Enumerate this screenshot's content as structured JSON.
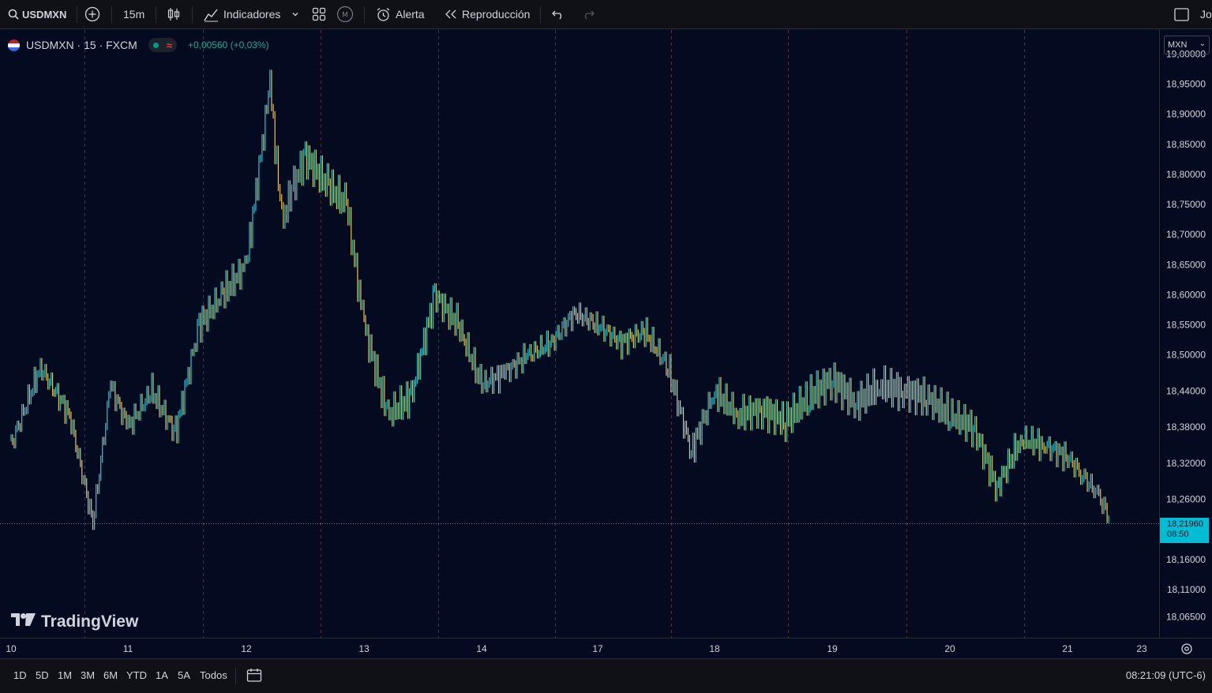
{
  "toolbar": {
    "symbol": "USDMXN",
    "interval": "15m",
    "indicators_label": "Indicadores",
    "alert_label": "Alerta",
    "replay_label": "Reproducción",
    "right_text": "Jo"
  },
  "legend": {
    "title": "USDMXN · 15 · FXCM",
    "change": "+0,00560 (+0,03%)"
  },
  "currency_select": "MXN",
  "price_axis": {
    "labels": [
      "19,00000",
      "18,95000",
      "18,90000",
      "18,85000",
      "18,80000",
      "18,75000",
      "18,70000",
      "18,65000",
      "18,60000",
      "18,55000",
      "18,50000",
      "18,44000",
      "18,38000",
      "18,32000",
      "18,26000",
      "18,16000",
      "18,11000",
      "18,06500"
    ],
    "current_price": "18,21960",
    "countdown": "08:50"
  },
  "time_axis": {
    "labels": [
      "10",
      "11",
      "12",
      "13",
      "14",
      "17",
      "18",
      "19",
      "20",
      "21",
      "23"
    ]
  },
  "ranges": [
    "1D",
    "5D",
    "1M",
    "3M",
    "6M",
    "YTD",
    "1A",
    "5A",
    "Todos"
  ],
  "clock": "08:21:09 (UTC-6)",
  "brand": "TradingView",
  "colors": {
    "up": "#26c6da",
    "down": "#e8c25a",
    "background": "#040b20",
    "price_line": "#00bcd4"
  },
  "chart_data": {
    "type": "line",
    "title": "USDMXN · 15 · FXCM",
    "xlabel": "",
    "ylabel": "",
    "ylim": [
      18.03,
      19.04
    ],
    "grid": "vertical dashed session separators",
    "categories": [
      "10",
      "11",
      "12",
      "13",
      "14",
      "17",
      "18",
      "19",
      "20",
      "21"
    ],
    "series": [
      {
        "x": [
          10.0,
          10.25,
          10.5,
          10.7,
          10.85,
          11.0,
          11.2,
          11.4,
          11.6,
          11.8,
          12.0,
          12.2,
          12.3,
          12.4,
          12.5,
          12.7,
          12.85,
          13.0,
          13.2,
          13.4,
          13.6,
          13.8,
          14.0,
          14.2,
          14.4,
          14.6,
          14.8,
          15.0,
          15.2,
          15.4,
          15.6,
          15.8,
          16.0,
          16.2,
          16.4,
          16.6,
          16.8,
          17.0,
          17.2,
          17.4,
          17.6,
          17.8,
          18.0,
          18.2,
          18.4,
          18.6,
          18.8,
          19.0,
          19.2,
          19.4,
          19.6,
          19.8,
          20.0,
          20.2,
          20.4,
          20.5,
          20.65,
          20.8,
          20.95
        ],
        "values": [
          18.35,
          18.48,
          18.4,
          18.22,
          18.45,
          18.38,
          18.44,
          18.37,
          18.55,
          18.6,
          18.65,
          18.95,
          18.72,
          18.78,
          18.83,
          18.78,
          18.75,
          18.55,
          18.4,
          18.43,
          18.6,
          18.55,
          18.45,
          18.47,
          18.5,
          18.52,
          18.57,
          18.55,
          18.52,
          18.54,
          18.48,
          18.34,
          18.44,
          18.4,
          18.41,
          18.39,
          18.43,
          18.46,
          18.42,
          18.45,
          18.44,
          18.43,
          18.4,
          18.38,
          18.28,
          18.36,
          18.35,
          18.33,
          18.3,
          18.27,
          18.22,
          18.23,
          18.22,
          18.22,
          18.22,
          18.22,
          18.22,
          18.22,
          18.22
        ]
      }
    ]
  }
}
